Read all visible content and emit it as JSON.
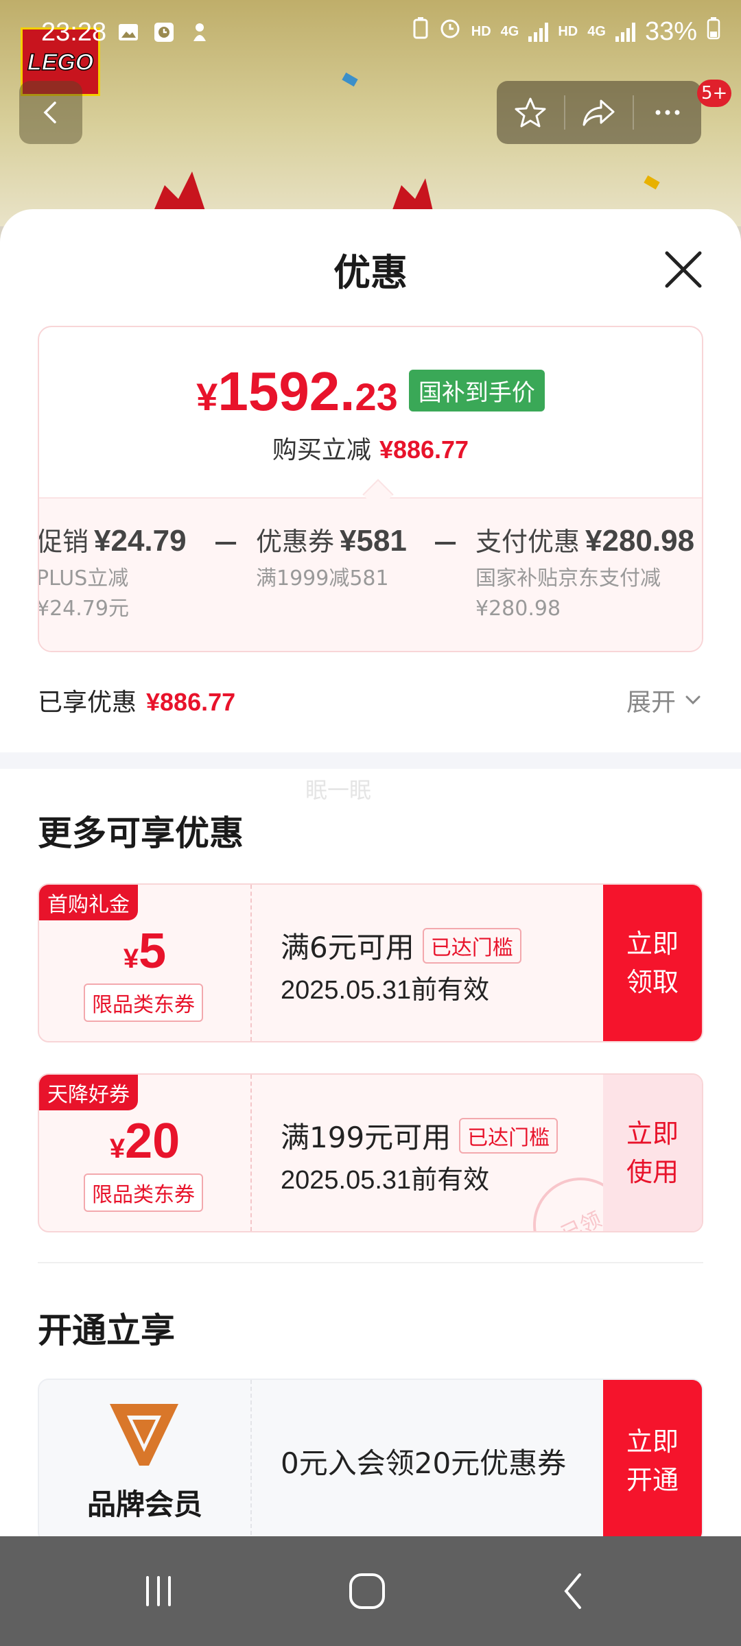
{
  "status_bar": {
    "time": "23:28",
    "network_1": "HD",
    "network_2": "4G",
    "network_3": "HD",
    "network_4": "4G",
    "battery": "33%",
    "icons": [
      "image-icon",
      "clock-app-icon",
      "mascot-icon",
      "battery-saver-icon",
      "alarm-icon",
      "signal-icon",
      "battery-icon"
    ]
  },
  "header": {
    "notification_count": "5+",
    "icons": [
      "back-icon",
      "star-icon",
      "share-icon",
      "more-icon"
    ],
    "brand_logo": "LEGO"
  },
  "sheet": {
    "title": "优惠",
    "close_icon": "close-icon"
  },
  "price": {
    "currency": "¥",
    "integer": "1592.",
    "decimal": "23",
    "tag": "国补到手价",
    "buy_reduce_label": "购买立减",
    "buy_reduce_amount": "¥886.77"
  },
  "breakdown": [
    {
      "name": "促销",
      "amount": "¥24.79",
      "desc": [
        "PLUS立减",
        "¥24.79元"
      ]
    },
    {
      "name": "优惠券",
      "amount": "¥581",
      "desc": [
        "满1999减581"
      ]
    },
    {
      "name": "支付优惠",
      "amount": "¥280.98",
      "desc": [
        "国家补贴京东支付减",
        "¥280.98"
      ]
    }
  ],
  "breakdown_minus": "−",
  "enjoyed": {
    "label": "已享优惠",
    "amount": "¥886.77",
    "expand": "展开"
  },
  "watermark": "眠一眠",
  "more_offers": {
    "title": "更多可享优惠",
    "coupons": [
      {
        "tag": "首购礼金",
        "currency": "¥",
        "amount": "5",
        "category": "限品类东券",
        "condition": "满6元可用",
        "badge": "已达门槛",
        "valid": "2025.05.31前有效",
        "button": [
          "立即",
          "领取"
        ],
        "button_style": "red"
      },
      {
        "tag": "天降好券",
        "currency": "¥",
        "amount": "20",
        "category": "限品类东券",
        "condition": "满199元可用",
        "badge": "已达门槛",
        "valid": "2025.05.31前有效",
        "button": [
          "立即",
          "使用"
        ],
        "button_style": "pink",
        "stamp": "已领"
      }
    ]
  },
  "membership": {
    "title": "开通立享",
    "name": "品牌会员",
    "desc": "0元入会领20元优惠券",
    "button": [
      "立即",
      "开通"
    ]
  },
  "colors": {
    "accent_red": "#e8132b",
    "button_red": "#f5142c",
    "subsidy_green": "#3aa857",
    "member_orange": "#d9772a"
  },
  "nav_bar": {
    "icons": [
      "recent-apps-icon",
      "home-icon",
      "back-nav-icon"
    ]
  }
}
